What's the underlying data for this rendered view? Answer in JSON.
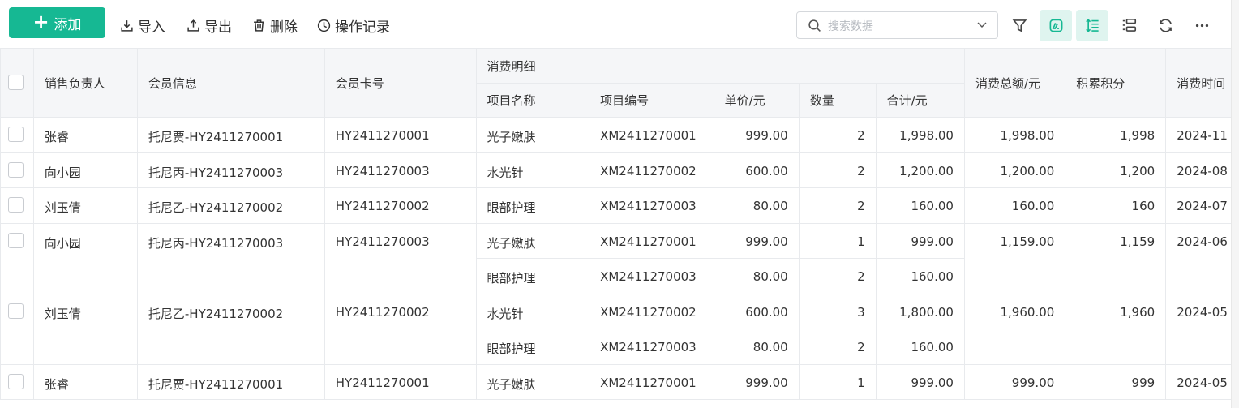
{
  "toolbar": {
    "add_label": "添加",
    "import_label": "导入",
    "export_label": "导出",
    "delete_label": "删除",
    "log_label": "操作记录",
    "search_placeholder": "搜索数据"
  },
  "table": {
    "headers": {
      "sales": "销售负责人",
      "member": "会员信息",
      "card": "会员卡号",
      "group": "消费明细",
      "item_name": "项目名称",
      "item_code": "项目编号",
      "unit_price": "单价/元",
      "qty": "数量",
      "subtotal": "合计/元",
      "total": "消费总额/元",
      "points": "积累积分",
      "time": "消费时间"
    },
    "rows": [
      {
        "sales": "张睿",
        "member": "托尼贾-HY2411270001",
        "card": "HY2411270001",
        "total": "1,998.00",
        "points": "1,998",
        "time": "2024-11",
        "items": [
          {
            "name": "光子嫩肤",
            "code": "XM2411270001",
            "price": "999.00",
            "qty": "2",
            "sub": "1,998.00"
          }
        ]
      },
      {
        "sales": "向小园",
        "member": "托尼丙-HY2411270003",
        "card": "HY2411270003",
        "total": "1,200.00",
        "points": "1,200",
        "time": "2024-08",
        "items": [
          {
            "name": "水光针",
            "code": "XM2411270002",
            "price": "600.00",
            "qty": "2",
            "sub": "1,200.00"
          }
        ]
      },
      {
        "sales": "刘玉倩",
        "member": "托尼乙-HY2411270002",
        "card": "HY2411270002",
        "total": "160.00",
        "points": "160",
        "time": "2024-07",
        "items": [
          {
            "name": "眼部护理",
            "code": "XM2411270003",
            "price": "80.00",
            "qty": "2",
            "sub": "160.00"
          }
        ]
      },
      {
        "sales": "向小园",
        "member": "托尼丙-HY2411270003",
        "card": "HY2411270003",
        "total": "1,159.00",
        "points": "1,159",
        "time": "2024-06",
        "items": [
          {
            "name": "光子嫩肤",
            "code": "XM2411270001",
            "price": "999.00",
            "qty": "1",
            "sub": "999.00"
          },
          {
            "name": "眼部护理",
            "code": "XM2411270003",
            "price": "80.00",
            "qty": "2",
            "sub": "160.00"
          }
        ]
      },
      {
        "sales": "刘玉倩",
        "member": "托尼乙-HY2411270002",
        "card": "HY2411270002",
        "total": "1,960.00",
        "points": "1,960",
        "time": "2024-05",
        "items": [
          {
            "name": "水光针",
            "code": "XM2411270002",
            "price": "600.00",
            "qty": "3",
            "sub": "1,800.00"
          },
          {
            "name": "眼部护理",
            "code": "XM2411270003",
            "price": "80.00",
            "qty": "2",
            "sub": "160.00"
          }
        ]
      },
      {
        "sales": "张睿",
        "member": "托尼贾-HY2411270001",
        "card": "HY2411270001",
        "total": "999.00",
        "points": "999",
        "time": "2024-05",
        "items": [
          {
            "name": "光子嫩肤",
            "code": "XM2411270001",
            "price": "999.00",
            "qty": "1",
            "sub": "999.00"
          }
        ]
      }
    ]
  },
  "colors": {
    "accent": "#16b893",
    "accent_light": "#dff4ef",
    "header_bg": "#f5f6f8",
    "border": "#e8eaed"
  }
}
